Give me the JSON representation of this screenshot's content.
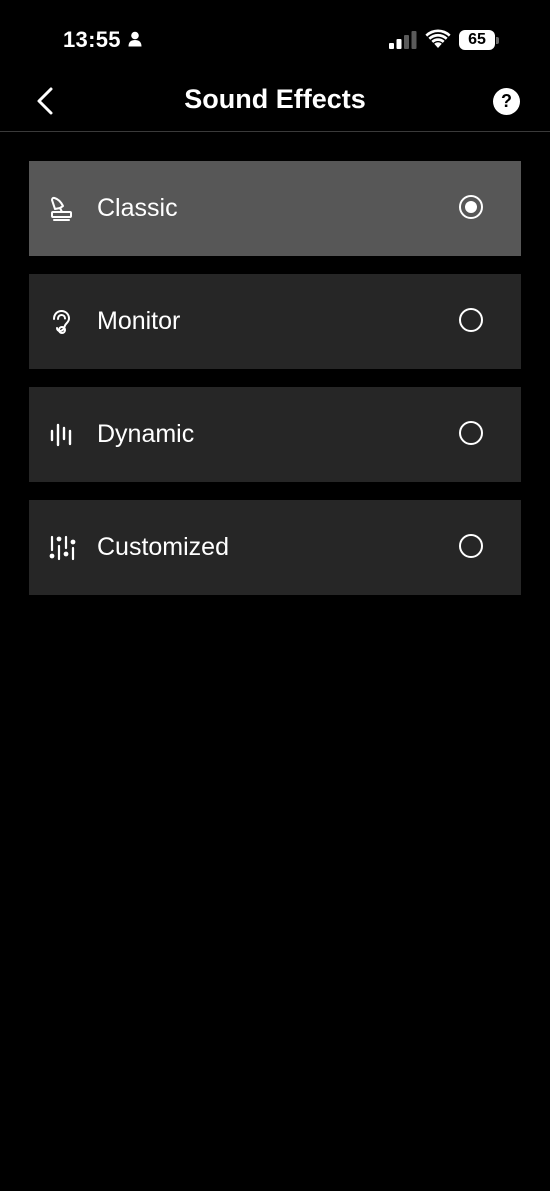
{
  "status_bar": {
    "time": "13:55",
    "battery": "65"
  },
  "nav": {
    "title": "Sound Effects",
    "help_label": "?"
  },
  "options": [
    {
      "label": "Classic",
      "icon": "gramophone-icon",
      "selected": true
    },
    {
      "label": "Monitor",
      "icon": "ear-icon",
      "selected": false
    },
    {
      "label": "Dynamic",
      "icon": "waveform-icon",
      "selected": false
    },
    {
      "label": "Customized",
      "icon": "equalizer-sliders-icon",
      "selected": false
    }
  ]
}
